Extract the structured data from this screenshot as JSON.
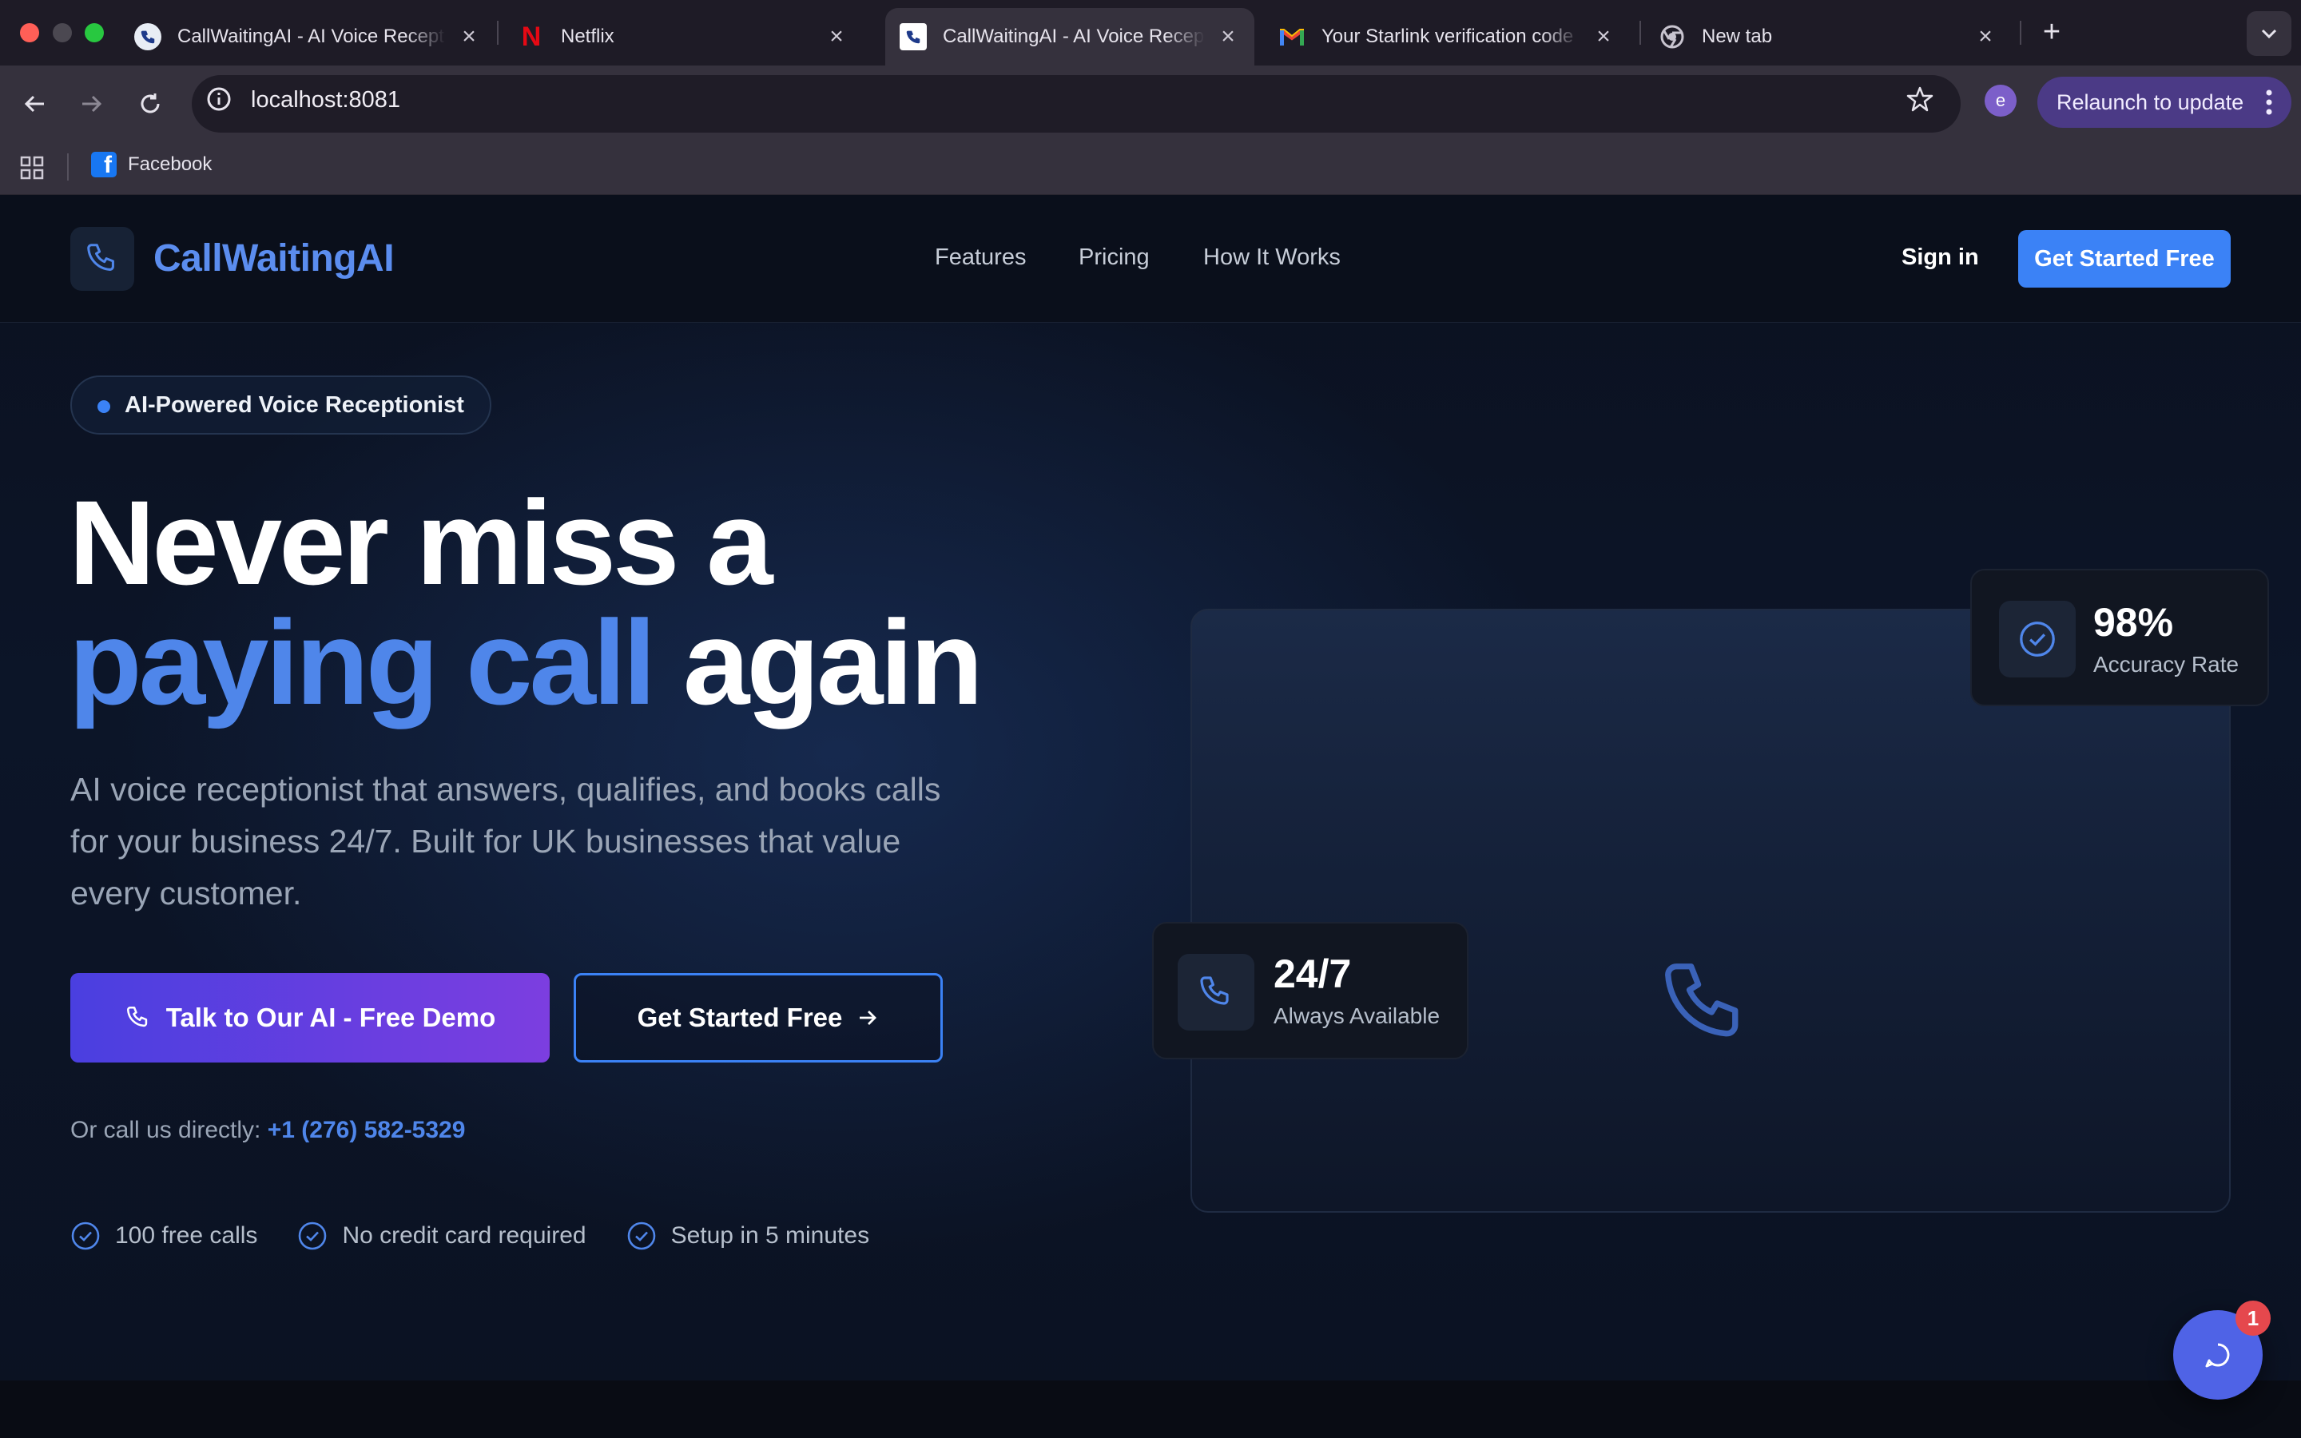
{
  "browser": {
    "tabs": [
      {
        "title": "CallWaitingAI - AI Voice Receptionist",
        "icon": "callwaitingai-favicon",
        "active": false
      },
      {
        "title": "Netflix",
        "icon": "netflix-favicon",
        "active": false
      },
      {
        "title": "CallWaitingAI - AI Voice Receptionist",
        "icon": "callwaitingai-favicon",
        "active": true
      },
      {
        "title": "Your Starlink verification code",
        "icon": "gmail-favicon",
        "active": false
      },
      {
        "title": "New tab",
        "icon": "chrome-favicon",
        "active": false
      }
    ],
    "url": "localhost:8081",
    "profile_initial": "e",
    "relaunch_label": "Relaunch to update",
    "bookmarks": [
      {
        "label": "Facebook",
        "icon": "facebook-icon"
      }
    ]
  },
  "header": {
    "logo_text": "CallWaitingAI",
    "nav": [
      "Features",
      "Pricing",
      "How It Works"
    ],
    "signin_label": "Sign in",
    "cta_label": "Get Started Free"
  },
  "hero": {
    "badge": "AI-Powered Voice Receptionist",
    "headline_line1": "Never miss a",
    "headline_accent": "paying call",
    "headline_rest": " again",
    "subtext": "AI voice receptionist that answers, qualifies, and books calls for your business 24/7. Built for UK businesses that value every customer.",
    "demo_button": "Talk to Our AI - Free Demo",
    "start_button": "Get Started Free",
    "call_prefix": "Or call us directly: ",
    "call_number": "+1 (276) 582-5329",
    "checks": [
      "100 free calls",
      "No credit card required",
      "Setup in 5 minutes"
    ]
  },
  "stats": {
    "accuracy_value": "98%",
    "accuracy_label": "Accuracy Rate",
    "availability_value": "24/7",
    "availability_label": "Always Available"
  },
  "chat": {
    "badge_count": "1"
  },
  "colors": {
    "accent": "#3b82f6",
    "brand_blue": "#4f86ea",
    "demo_gradient_start": "#4a3fe0",
    "demo_gradient_end": "#7c3ee0",
    "chat_fab": "#4f63e6",
    "notification_red": "#e5484d"
  }
}
